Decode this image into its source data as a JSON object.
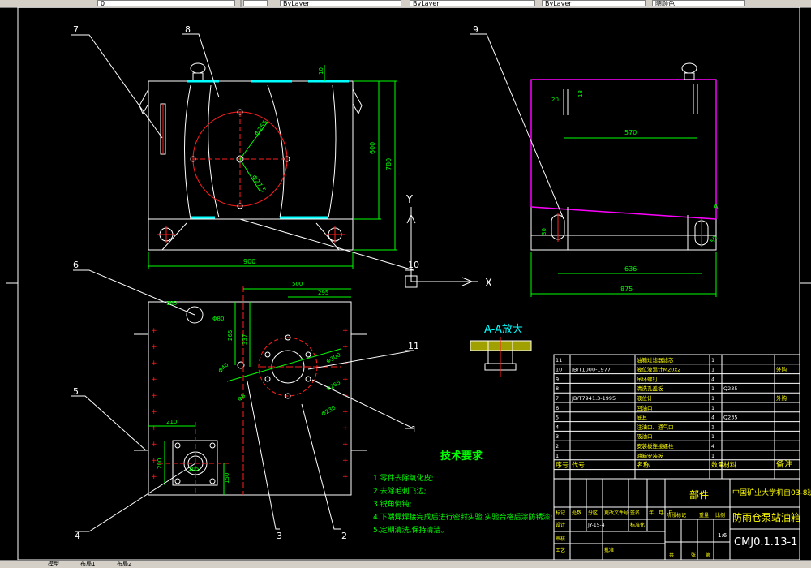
{
  "toolbar": {
    "layer_value": "0",
    "color_value": "ByLayer",
    "linetype_value": "ByLayer",
    "lineweight_value": "ByLayer",
    "plotstyle_value": "随颜色"
  },
  "labels": {
    "callout_7": "7",
    "callout_8": "8",
    "callout_9": "9",
    "callout_6": "6",
    "callout_5": "5",
    "callout_4": "4",
    "callout_3": "3",
    "callout_2": "2",
    "callout_1": "1",
    "callout_10": "10",
    "callout_11": "11",
    "axis_y": "Y",
    "axis_x": "X",
    "section_title": "A-A放大"
  },
  "dims": {
    "front_width": "900",
    "front_h1": "600",
    "front_h2": "780",
    "front_top": "10",
    "front_r": "Φ255",
    "front_r2": "Φ27.5",
    "side_570": "570",
    "side_20": "20",
    "side_18": "18",
    "side_30": "30",
    "side_636": "636",
    "side_875": "875",
    "side_50": "50",
    "side_a": "A",
    "top_500": "500",
    "top_295": "295",
    "top_185": "185",
    "top_80": "Φ80",
    "top_265": "265",
    "top_337": "337",
    "top_300": "Φ300",
    "top_40": "Φ40",
    "top_265b": "Φ265",
    "top_8": "Φ8",
    "top_230": "Φ230",
    "top_210": "210",
    "top_105": "105",
    "top_200": "200",
    "top_150": "150"
  },
  "tech": {
    "title": "技术要求",
    "items": [
      "1.零件去除氧化皮;",
      "2.去除毛刺飞边;",
      "3.锐角倒钝;",
      "4.下端焊焊接完成后进行密封实验,实验合格后涂防锈漆;",
      "5.定期清洗,保持清洁。"
    ]
  },
  "bom": {
    "rows": [
      {
        "no": "11",
        "code": "",
        "name": "油箱过滤器滤芯",
        "qty": "1",
        "mat": "",
        "note": ""
      },
      {
        "no": "10",
        "code": "JB/T1000-1977",
        "name": "液位液温计M20x2",
        "qty": "1",
        "mat": "",
        "note": "外购"
      },
      {
        "no": "9",
        "code": "",
        "name": "吊环螺钉",
        "qty": "4",
        "mat": "",
        "note": ""
      },
      {
        "no": "8",
        "code": "",
        "name": "清洗孔盖板",
        "qty": "1",
        "mat": "Q235",
        "note": ""
      },
      {
        "no": "7",
        "code": "JB/T7941.3-1995",
        "name": "液位计",
        "qty": "1",
        "mat": "",
        "note": "外购"
      },
      {
        "no": "6",
        "code": "",
        "name": "回油口",
        "qty": "1",
        "mat": "",
        "note": ""
      },
      {
        "no": "5",
        "code": "",
        "name": "底耳",
        "qty": "4",
        "mat": "Q235",
        "note": ""
      },
      {
        "no": "4",
        "code": "",
        "name": "注油口、通气口",
        "qty": "1",
        "mat": "",
        "note": ""
      },
      {
        "no": "3",
        "code": "",
        "name": "吸油口",
        "qty": "1",
        "mat": "",
        "note": ""
      },
      {
        "no": "2",
        "code": "",
        "name": "安装板连接螺栓",
        "qty": "4",
        "mat": "",
        "note": ""
      },
      {
        "no": "1",
        "code": "",
        "name": "油箱安装板",
        "qty": "1",
        "mat": "",
        "note": ""
      }
    ],
    "header": {
      "no": "序号",
      "code": "代号",
      "name": "名称",
      "qty": "数量",
      "mat": "材料",
      "note": "备注"
    }
  },
  "titleblock": {
    "school": "中国矿业大学机自03-8班",
    "part_type": "部件",
    "drawing_name": "防雨仓泵站油箱",
    "drawing_no": "CMJ0.1.13-1",
    "scale": "1:6",
    "r_biaoji": "标记",
    "r_chushu": "处数",
    "r_fenqu": "分区",
    "r_gengai": "更改文件号",
    "r_qianming": "签名",
    "r_nianyueri": "年、月、日",
    "r_sheji": "设计",
    "r_biaozhunhua": "标准化",
    "r_shenhe": "审核",
    "r_gongyi": "工艺",
    "r_pizhun": "批准",
    "r_jieduan": "阶段标记",
    "r_zhongliang": "重量",
    "r_bili": "比例",
    "r_gong": "共",
    "r_zhang": "张",
    "r_di": "第",
    "r_note_extra": "JY-15-4"
  },
  "status": {
    "tab_model": "模型",
    "tab_layout1": "布局1",
    "tab_layout2": "布局2"
  },
  "colors": {
    "white": "#ffffff",
    "yellow": "#ffff00",
    "cyan": "#00ffff",
    "green": "#00ff00",
    "red": "#ff2020",
    "magenta": "#ff00ff"
  }
}
